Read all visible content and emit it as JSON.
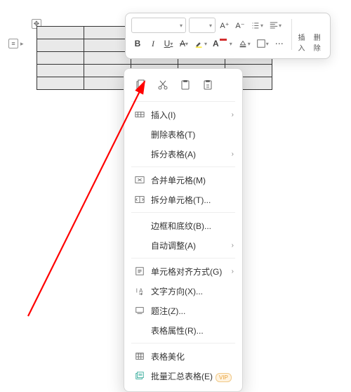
{
  "toolbar": {
    "font_name_placeholder": "",
    "font_size_placeholder": "",
    "increase_font": "A⁺",
    "decrease_font": "A⁻",
    "bold": "B",
    "italic": "I",
    "underline": "U",
    "strike": "A",
    "insert_label": "插入",
    "delete_label": "删除"
  },
  "left_gutter": {
    "icon": "≡"
  },
  "table_handle": {
    "icon": "✥"
  },
  "table": {
    "rows": 5,
    "cols": 5
  },
  "context_menu": {
    "items": [
      {
        "label": "插入(I)",
        "has_sub": true,
        "icon": "insert"
      },
      {
        "label": "删除表格(T)",
        "has_sub": false,
        "icon": ""
      },
      {
        "label": "拆分表格(A)",
        "has_sub": true,
        "icon": ""
      },
      {
        "label": "合并单元格(M)",
        "has_sub": false,
        "icon": "merge"
      },
      {
        "label": "拆分单元格(T)...",
        "has_sub": false,
        "icon": "split"
      },
      {
        "label": "边框和底纹(B)...",
        "has_sub": false,
        "icon": ""
      },
      {
        "label": "自动调整(A)",
        "has_sub": true,
        "icon": ""
      },
      {
        "label": "单元格对齐方式(G)",
        "has_sub": true,
        "icon": "align"
      },
      {
        "label": "文字方向(X)...",
        "has_sub": false,
        "icon": "textdir"
      },
      {
        "label": "题注(Z)...",
        "has_sub": false,
        "icon": "caption"
      },
      {
        "label": "表格属性(R)...",
        "has_sub": false,
        "icon": ""
      },
      {
        "label": "表格美化",
        "has_sub": false,
        "icon": "beautify"
      },
      {
        "label": "批量汇总表格(E)",
        "has_sub": false,
        "icon": "batch",
        "vip": "VIP"
      }
    ]
  },
  "colors": {
    "arrow": "#ff0000"
  }
}
